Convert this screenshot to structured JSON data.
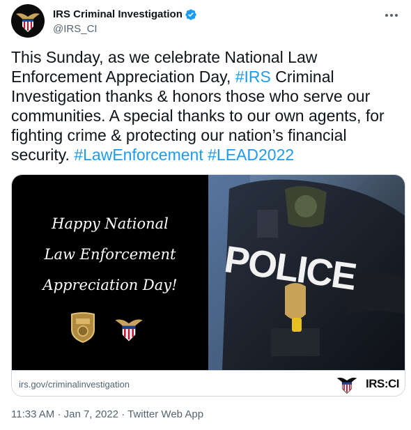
{
  "author": {
    "display_name": "IRS Criminal Investigation",
    "handle": "@IRS_CI"
  },
  "tweet": {
    "text_before": "This Sunday, as we celebrate National Law Enforcement Appreciation Day, ",
    "hashtag_1": "#IRS",
    "text_middle": " Criminal Investigation thanks & honors those who serve our communities. A special thanks to our own agents, for fighting crime & protecting our nation’s financial security. ",
    "hashtag_2": "#LawEnforcement",
    "hashtag_3": "#LEAD2022"
  },
  "card": {
    "greeting_line_1": "Happy National",
    "greeting_line_2": "Law Enforcement",
    "greeting_line_3": "Appreciation Day!",
    "vest_text": "POLICE",
    "domain": "irs.gov/criminalinvestigation",
    "logo_text": "IRS:CI"
  },
  "meta": {
    "time": "11:33 AM",
    "separator": "·",
    "date": "Jan 7, 2022",
    "source": "Twitter Web App"
  },
  "colors": {
    "link": "#1d9bf0",
    "secondary_text": "#536471",
    "border": "#cfd9de",
    "verified": "#1d9bf0"
  }
}
